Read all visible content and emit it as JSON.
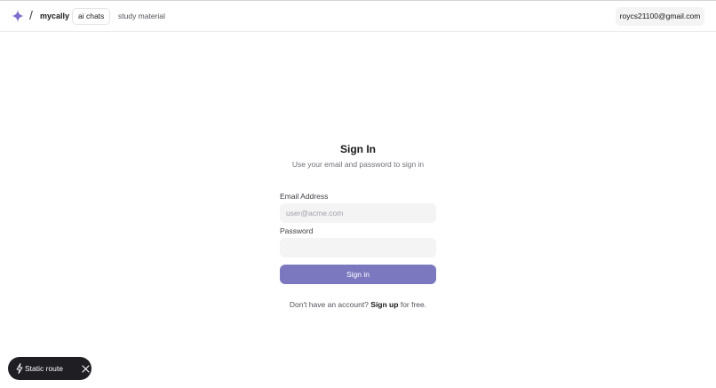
{
  "header": {
    "brand": "mycally",
    "separator": "/",
    "ai_chats_label": "ai chats",
    "study_material_label": "study material",
    "account_email": "roycs21100@gmail.com",
    "logo_color": "#7c6fcf"
  },
  "signin": {
    "title": "Sign In",
    "subtitle": "Use your email and password to sign in",
    "email_label": "Email Address",
    "email_placeholder": "user@acme.com",
    "password_label": "Password",
    "button_label": "Sign in",
    "button_color": "#7c78c0",
    "footer_prefix": "Don't have an account?",
    "signup_link": "Sign up",
    "footer_suffix": "for free."
  },
  "toast": {
    "label": "Static route",
    "icons": [
      "bolt-icon",
      "close-icon"
    ]
  }
}
